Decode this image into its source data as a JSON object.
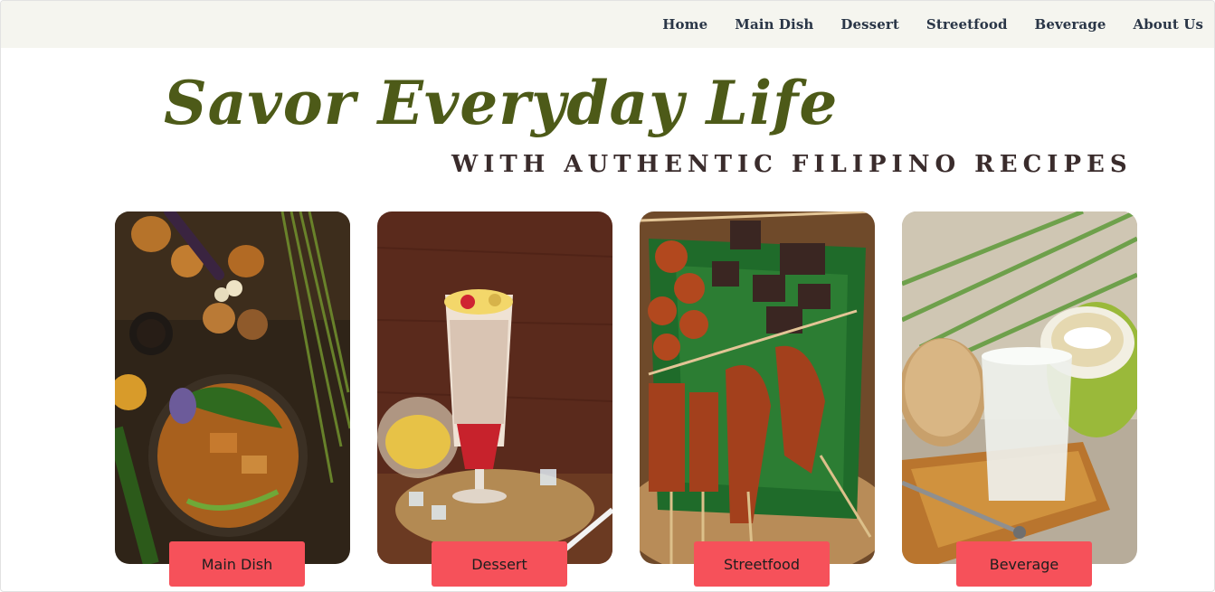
{
  "nav": {
    "items": [
      {
        "id": "home",
        "label": "Home"
      },
      {
        "id": "main-dish",
        "label": "Main Dish"
      },
      {
        "id": "dessert",
        "label": "Dessert"
      },
      {
        "id": "streetfood",
        "label": "Streetfood"
      },
      {
        "id": "beverage",
        "label": "Beverage"
      },
      {
        "id": "about-us",
        "label": "About Us"
      }
    ]
  },
  "hero": {
    "title": "Savor Everyday Life",
    "subtitle": "WITH AUTHENTIC FILIPINO RECIPES"
  },
  "categories": [
    {
      "label": "Main Dish",
      "image": "kare-kare dish photo"
    },
    {
      "label": "Dessert",
      "image": "halo-halo dessert photo"
    },
    {
      "label": "Streetfood",
      "image": "grilled streetfood skewers photo"
    },
    {
      "label": "Beverage",
      "image": "buko coconut juice photo"
    }
  ],
  "colors": {
    "nav_bg": "#f5f5ef",
    "nav_text": "#2a3647",
    "title": "#4d5a18",
    "subtitle": "#3a2c2c",
    "button": "#f6515a"
  }
}
